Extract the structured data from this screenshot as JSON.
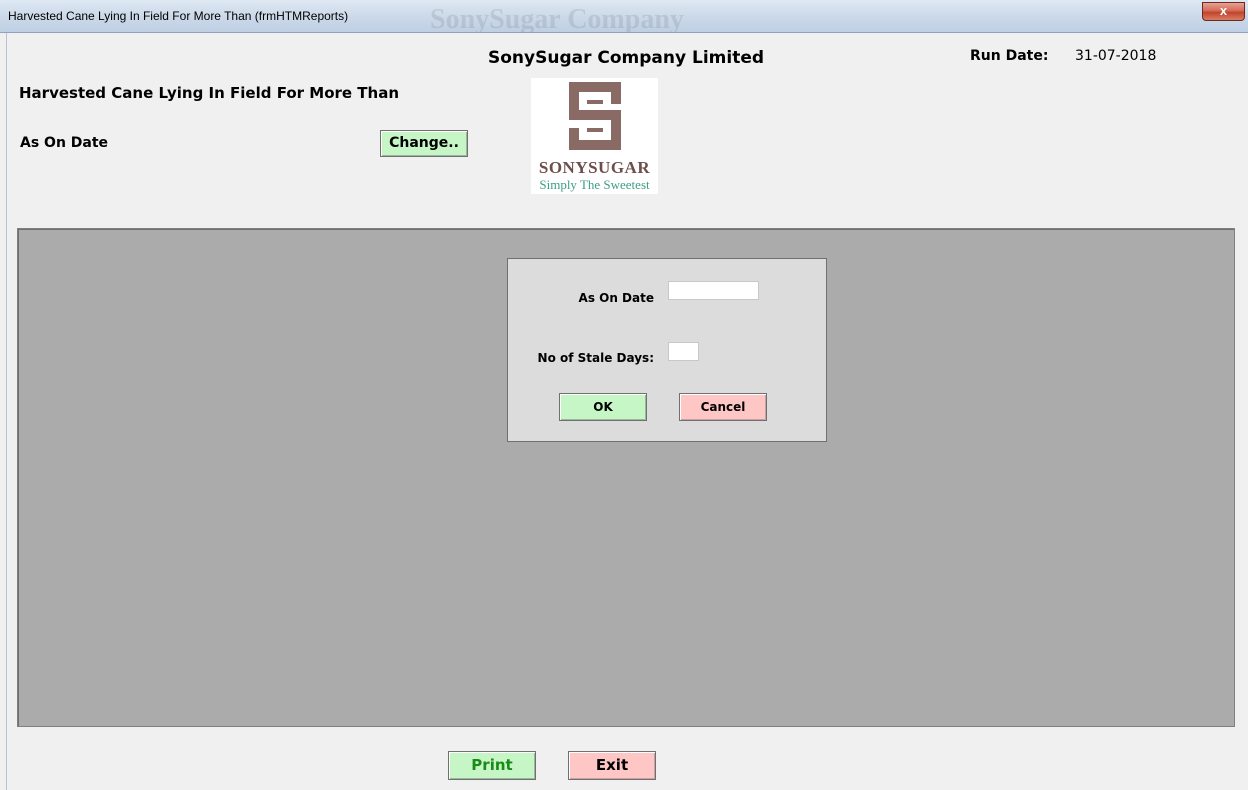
{
  "window": {
    "title": "Harvested Cane Lying In Field For More Than  (frmHTMReports)",
    "background_title": "SonySugar Company",
    "close_icon": "close-icon",
    "close_symbol": "x"
  },
  "header": {
    "company_name": "SonySugar Company Limited",
    "run_date_label": "Run Date:",
    "run_date_value": "31-07-2018",
    "report_title": "Harvested Cane Lying In Field For More Than",
    "as_on_label": "As On Date",
    "change_button": "Change.."
  },
  "logo": {
    "name": "SONYSUGAR",
    "tagline": "Simply The Sweetest",
    "mark_color": "#8a6a64"
  },
  "dialog": {
    "as_on_date_label": "As On Date",
    "as_on_date_value": "",
    "stale_days_label": "No of Stale Days:",
    "stale_days_value": "",
    "ok_label": "OK",
    "cancel_label": "Cancel"
  },
  "footer": {
    "print_label": "Print",
    "exit_label": "Exit"
  },
  "colors": {
    "green_button": "#c6f6c6",
    "red_button": "#ffc6c6",
    "print_text": "#1a8a1a",
    "panel_gray": "#ababab"
  }
}
